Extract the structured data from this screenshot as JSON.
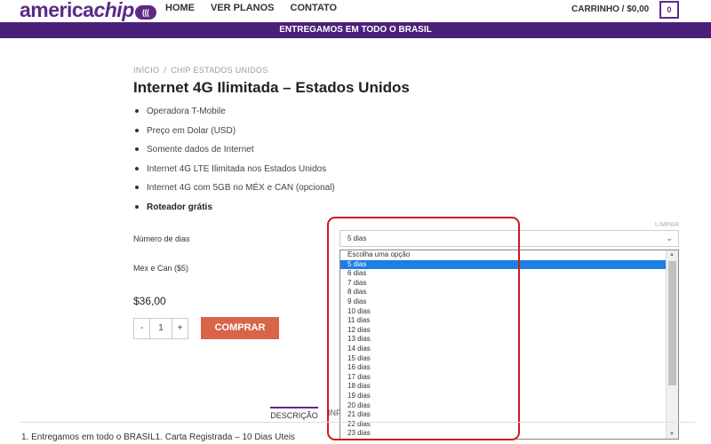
{
  "header": {
    "logo_main": "america",
    "logo_chip": "chip",
    "logo_badge": "(((",
    "nav": [
      "HOME",
      "VER PLANOS",
      "CONTATO"
    ],
    "cart_label": "CARRINHO / $0,00",
    "cart_count": "0"
  },
  "banner": "ENTREGAMOS EM TODO O BRASIL",
  "breadcrumb": [
    "INÍCIO",
    "/",
    "CHIP ESTADOS UNIDOS"
  ],
  "product": {
    "title": "Internet 4G Ilimitada – Estados Unidos",
    "features": [
      "Operadora T-Mobile",
      "Preço em Dolar (USD)",
      "Somente dados de Internet",
      "Internet 4G LTE Ilimitada nos Estados Unidos",
      "Internet 4G com 5GB no MÉX e CAN (opcional)",
      "Roteador grátis"
    ],
    "limpar": "LIMPAR",
    "days_label": "Número de dias",
    "mex_label": "Méx e Can ($5)",
    "selected_value": "5 dias",
    "options": [
      "Escolha uma opção",
      "5 dias",
      "6 dias",
      "7 dias",
      "8 dias",
      "9 dias",
      "10 dias",
      "11 dias",
      "12 dias",
      "13 dias",
      "14 dias",
      "15 dias",
      "16 dias",
      "17 dias",
      "18 dias",
      "19 dias",
      "20 dias",
      "21 dias",
      "22 dias",
      "23 dias"
    ],
    "price": "$36,00",
    "qty_minus": "-",
    "qty_value": "1",
    "qty_plus": "+",
    "buy_label": "COMPRAR"
  },
  "tabs": {
    "desc": "DESCRIÇÃO",
    "info": "INF"
  },
  "bottom_text": "1. Entregamos em todo o BRASIL1. Carta Registrada – 10 Dias Uteis",
  "colors": {
    "brand": "#5b2b86",
    "banner": "#4b2079",
    "buy": "#d8654a",
    "selected": "#1e7ee5",
    "highlight": "#d01818"
  }
}
